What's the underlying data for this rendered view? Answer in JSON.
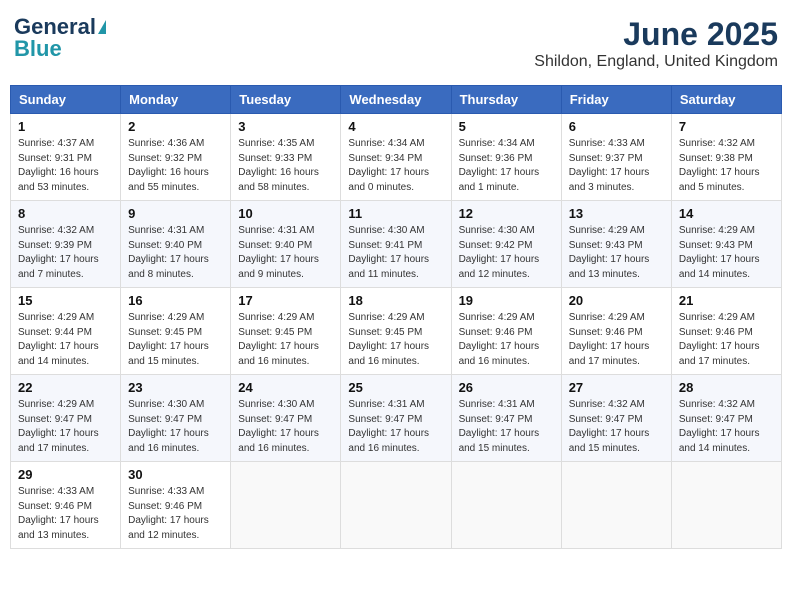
{
  "header": {
    "logo_line1": "General",
    "logo_line2": "Blue",
    "month_title": "June 2025",
    "location": "Shildon, England, United Kingdom"
  },
  "days_of_week": [
    "Sunday",
    "Monday",
    "Tuesday",
    "Wednesday",
    "Thursday",
    "Friday",
    "Saturday"
  ],
  "weeks": [
    [
      {
        "day": "1",
        "info": "Sunrise: 4:37 AM\nSunset: 9:31 PM\nDaylight: 16 hours\nand 53 minutes."
      },
      {
        "day": "2",
        "info": "Sunrise: 4:36 AM\nSunset: 9:32 PM\nDaylight: 16 hours\nand 55 minutes."
      },
      {
        "day": "3",
        "info": "Sunrise: 4:35 AM\nSunset: 9:33 PM\nDaylight: 16 hours\nand 58 minutes."
      },
      {
        "day": "4",
        "info": "Sunrise: 4:34 AM\nSunset: 9:34 PM\nDaylight: 17 hours\nand 0 minutes."
      },
      {
        "day": "5",
        "info": "Sunrise: 4:34 AM\nSunset: 9:36 PM\nDaylight: 17 hours\nand 1 minute."
      },
      {
        "day": "6",
        "info": "Sunrise: 4:33 AM\nSunset: 9:37 PM\nDaylight: 17 hours\nand 3 minutes."
      },
      {
        "day": "7",
        "info": "Sunrise: 4:32 AM\nSunset: 9:38 PM\nDaylight: 17 hours\nand 5 minutes."
      }
    ],
    [
      {
        "day": "8",
        "info": "Sunrise: 4:32 AM\nSunset: 9:39 PM\nDaylight: 17 hours\nand 7 minutes."
      },
      {
        "day": "9",
        "info": "Sunrise: 4:31 AM\nSunset: 9:40 PM\nDaylight: 17 hours\nand 8 minutes."
      },
      {
        "day": "10",
        "info": "Sunrise: 4:31 AM\nSunset: 9:40 PM\nDaylight: 17 hours\nand 9 minutes."
      },
      {
        "day": "11",
        "info": "Sunrise: 4:30 AM\nSunset: 9:41 PM\nDaylight: 17 hours\nand 11 minutes."
      },
      {
        "day": "12",
        "info": "Sunrise: 4:30 AM\nSunset: 9:42 PM\nDaylight: 17 hours\nand 12 minutes."
      },
      {
        "day": "13",
        "info": "Sunrise: 4:29 AM\nSunset: 9:43 PM\nDaylight: 17 hours\nand 13 minutes."
      },
      {
        "day": "14",
        "info": "Sunrise: 4:29 AM\nSunset: 9:43 PM\nDaylight: 17 hours\nand 14 minutes."
      }
    ],
    [
      {
        "day": "15",
        "info": "Sunrise: 4:29 AM\nSunset: 9:44 PM\nDaylight: 17 hours\nand 14 minutes."
      },
      {
        "day": "16",
        "info": "Sunrise: 4:29 AM\nSunset: 9:45 PM\nDaylight: 17 hours\nand 15 minutes."
      },
      {
        "day": "17",
        "info": "Sunrise: 4:29 AM\nSunset: 9:45 PM\nDaylight: 17 hours\nand 16 minutes."
      },
      {
        "day": "18",
        "info": "Sunrise: 4:29 AM\nSunset: 9:45 PM\nDaylight: 17 hours\nand 16 minutes."
      },
      {
        "day": "19",
        "info": "Sunrise: 4:29 AM\nSunset: 9:46 PM\nDaylight: 17 hours\nand 16 minutes."
      },
      {
        "day": "20",
        "info": "Sunrise: 4:29 AM\nSunset: 9:46 PM\nDaylight: 17 hours\nand 17 minutes."
      },
      {
        "day": "21",
        "info": "Sunrise: 4:29 AM\nSunset: 9:46 PM\nDaylight: 17 hours\nand 17 minutes."
      }
    ],
    [
      {
        "day": "22",
        "info": "Sunrise: 4:29 AM\nSunset: 9:47 PM\nDaylight: 17 hours\nand 17 minutes."
      },
      {
        "day": "23",
        "info": "Sunrise: 4:30 AM\nSunset: 9:47 PM\nDaylight: 17 hours\nand 16 minutes."
      },
      {
        "day": "24",
        "info": "Sunrise: 4:30 AM\nSunset: 9:47 PM\nDaylight: 17 hours\nand 16 minutes."
      },
      {
        "day": "25",
        "info": "Sunrise: 4:31 AM\nSunset: 9:47 PM\nDaylight: 17 hours\nand 16 minutes."
      },
      {
        "day": "26",
        "info": "Sunrise: 4:31 AM\nSunset: 9:47 PM\nDaylight: 17 hours\nand 15 minutes."
      },
      {
        "day": "27",
        "info": "Sunrise: 4:32 AM\nSunset: 9:47 PM\nDaylight: 17 hours\nand 15 minutes."
      },
      {
        "day": "28",
        "info": "Sunrise: 4:32 AM\nSunset: 9:47 PM\nDaylight: 17 hours\nand 14 minutes."
      }
    ],
    [
      {
        "day": "29",
        "info": "Sunrise: 4:33 AM\nSunset: 9:46 PM\nDaylight: 17 hours\nand 13 minutes."
      },
      {
        "day": "30",
        "info": "Sunrise: 4:33 AM\nSunset: 9:46 PM\nDaylight: 17 hours\nand 12 minutes."
      },
      {
        "day": "",
        "info": ""
      },
      {
        "day": "",
        "info": ""
      },
      {
        "day": "",
        "info": ""
      },
      {
        "day": "",
        "info": ""
      },
      {
        "day": "",
        "info": ""
      }
    ]
  ]
}
